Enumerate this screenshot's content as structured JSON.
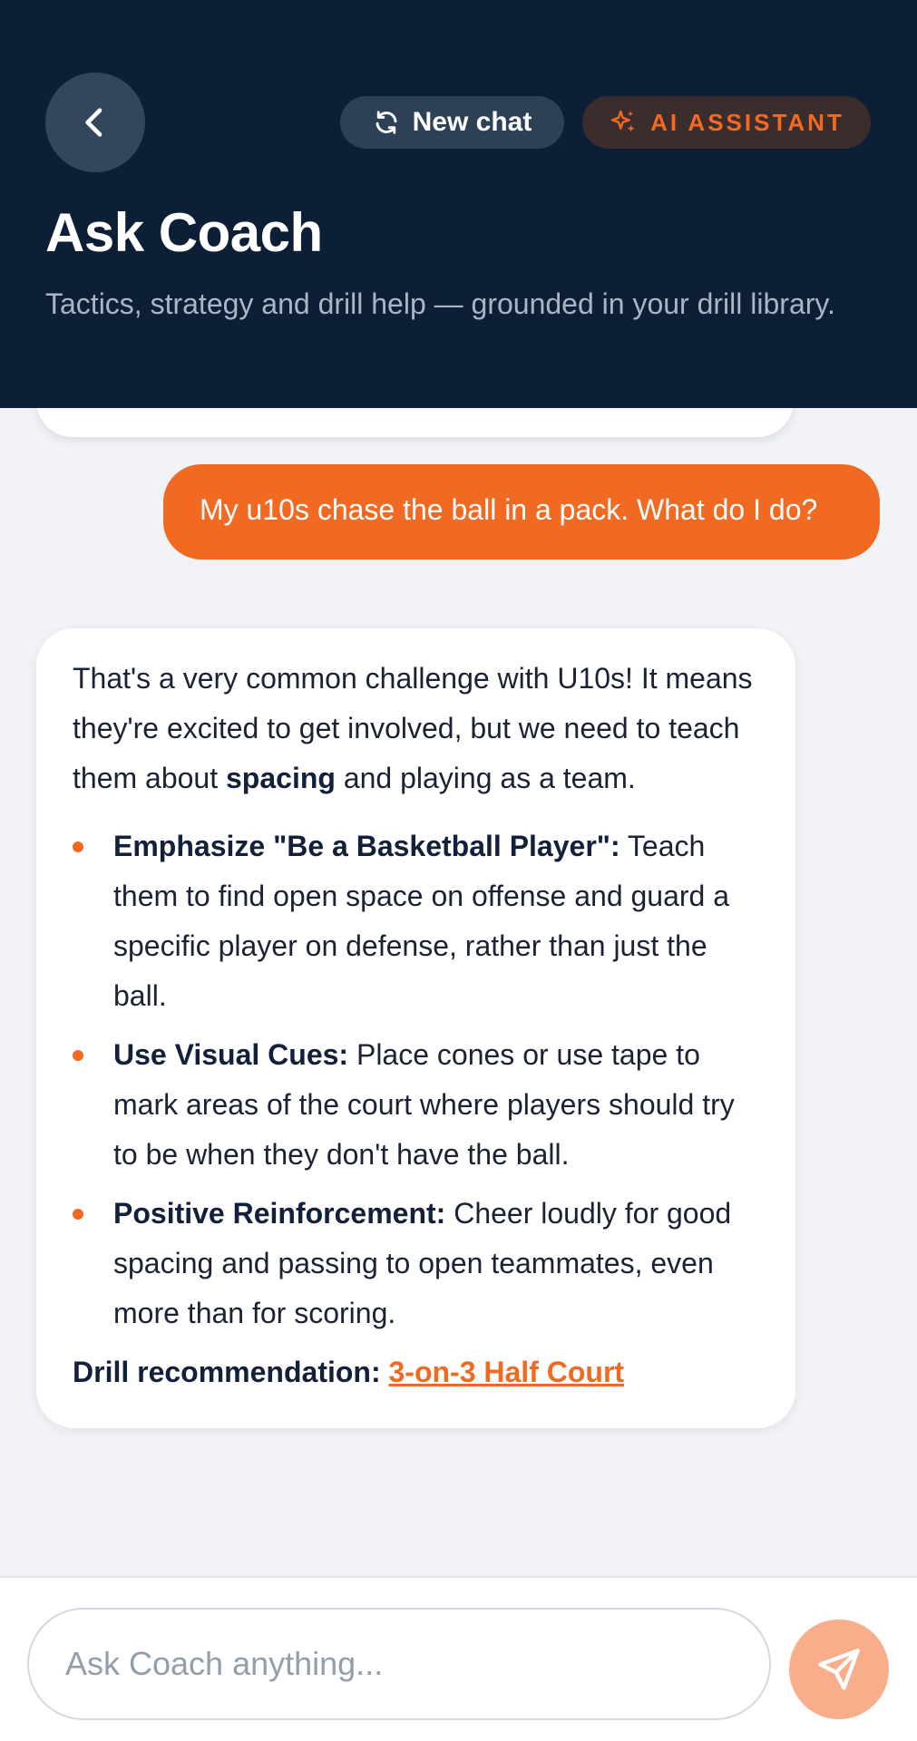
{
  "header": {
    "title": "Ask Coach",
    "subtitle": "Tactics, strategy and drill help — grounded in your drill library.",
    "new_chat_label": "New chat",
    "ai_badge_label": "AI ASSISTANT"
  },
  "messages": {
    "user": "My u10s chase the ball in a pack. What do I do?",
    "assistant": {
      "intro_part1": "That's a very common challenge with U10s! It means they're excited to get involved, but we need to teach them about ",
      "intro_bold": "spacing",
      "intro_part2": " and playing as a team.",
      "bullets": [
        {
          "title": "Emphasize \"Be a Basketball Player\":",
          "text": " Teach them to find open space on offense and guard a specific player on defense, rather than just the ball."
        },
        {
          "title": "Use Visual Cues:",
          "text": " Place cones or use tape to mark areas of the court where players should try to be when they don't have the ball."
        },
        {
          "title": "Positive Reinforcement:",
          "text": " Cheer loudly for good spacing and passing to open teammates, even more than for scoring."
        }
      ],
      "drill_label": "Drill recommendation:",
      "drill_link": "3-on-3 Half Court"
    }
  },
  "composer": {
    "placeholder": "Ask Coach anything..."
  },
  "icons": {
    "back": "chevron-left-icon",
    "new_chat": "refresh-icon",
    "ai": "sparkles-icon",
    "send": "send-icon"
  },
  "colors": {
    "header_bg": "#0d1f36",
    "accent": "#f26a22",
    "send_button": "#f9ad8a",
    "page_bg": "#f1f3f7"
  }
}
